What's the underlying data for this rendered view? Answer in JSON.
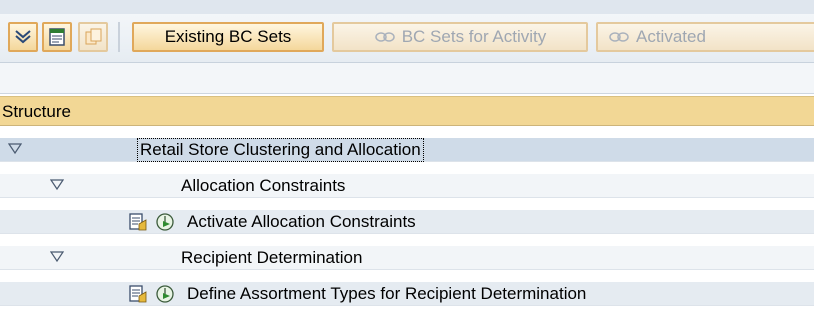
{
  "toolbar": {
    "existing_bc_sets_label": "Existing BC Sets",
    "bc_sets_for_activity_label": "BC Sets for Activity",
    "activated_label": "Activated"
  },
  "tree": {
    "column_header": "Structure",
    "rows": [
      {
        "label": "Retail Store Clustering and Allocation"
      },
      {
        "label": "Allocation Constraints"
      },
      {
        "label": "Activate Allocation Constraints"
      },
      {
        "label": "Recipient Determination"
      },
      {
        "label": "Define Assortment Types for Recipient Determination"
      }
    ]
  },
  "colors": {
    "header_bg": "#f2d795",
    "selected_row_bg": "#cfdbe8",
    "button_border": "#e0a85a"
  }
}
